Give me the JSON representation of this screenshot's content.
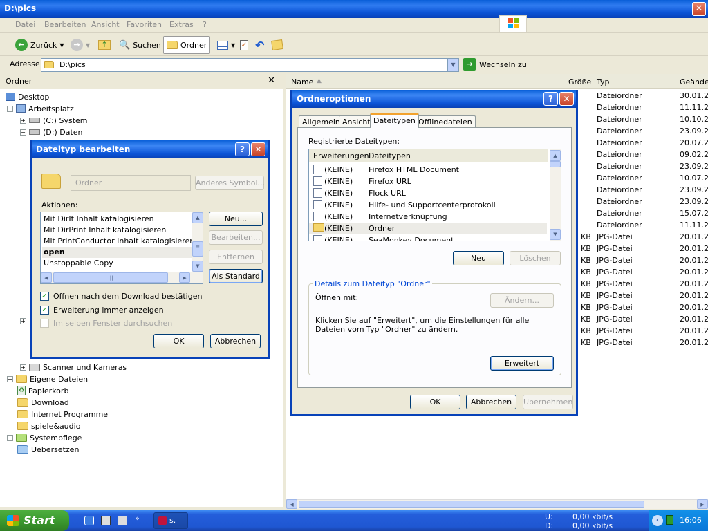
{
  "window": {
    "title": "D:\\pics"
  },
  "menu": [
    "Datei",
    "Bearbeiten",
    "Ansicht",
    "Favoriten",
    "Extras",
    "?"
  ],
  "toolbar": {
    "back": "Zurück",
    "search": "Suchen",
    "folders": "Ordner"
  },
  "address": {
    "label": "Adresse",
    "value": "D:\\pics",
    "go": "Wechseln zu"
  },
  "tree": {
    "header": "Ordner",
    "items": [
      {
        "label": "Desktop"
      },
      {
        "label": "Arbeitsplatz"
      },
      {
        "label": "(C:) System"
      },
      {
        "label": "(D:) Daten"
      },
      {
        "label": "Scanner und Kameras"
      },
      {
        "label": "Eigene Dateien"
      },
      {
        "label": "Papierkorb"
      },
      {
        "label": "Download"
      },
      {
        "label": "Internet Programme"
      },
      {
        "label": "spiele&audio"
      },
      {
        "label": "Systempflege"
      },
      {
        "label": "Uebersetzen"
      }
    ]
  },
  "list": {
    "headers": {
      "name": "Name",
      "size": "Größe",
      "type": "Typ",
      "changed": "Geände"
    },
    "rows": [
      {
        "size": "",
        "type": "Dateiordner",
        "date": "30.01.2"
      },
      {
        "size": "",
        "type": "Dateiordner",
        "date": "11.11.2"
      },
      {
        "size": "",
        "type": "Dateiordner",
        "date": "10.10.2"
      },
      {
        "size": "",
        "type": "Dateiordner",
        "date": "23.09.2"
      },
      {
        "size": "",
        "type": "Dateiordner",
        "date": "20.07.2"
      },
      {
        "size": "",
        "type": "Dateiordner",
        "date": "09.02.2"
      },
      {
        "size": "",
        "type": "Dateiordner",
        "date": "23.09.2"
      },
      {
        "size": "",
        "type": "Dateiordner",
        "date": "10.07.2"
      },
      {
        "size": "",
        "type": "Dateiordner",
        "date": "23.09.2"
      },
      {
        "size": "",
        "type": "Dateiordner",
        "date": "23.09.2"
      },
      {
        "size": "",
        "type": "Dateiordner",
        "date": "15.07.2"
      },
      {
        "size": "",
        "type": "Dateiordner",
        "date": "11.11.2"
      },
      {
        "size": "KB",
        "type": "JPG-Datei",
        "date": "20.01.2"
      },
      {
        "size": "KB",
        "type": "JPG-Datei",
        "date": "20.01.2"
      },
      {
        "size": "KB",
        "type": "JPG-Datei",
        "date": "20.01.2"
      },
      {
        "size": "KB",
        "type": "JPG-Datei",
        "date": "20.01.2"
      },
      {
        "size": "KB",
        "type": "JPG-Datei",
        "date": "20.01.2"
      },
      {
        "size": "KB",
        "type": "JPG-Datei",
        "date": "20.01.2"
      },
      {
        "size": "KB",
        "type": "JPG-Datei",
        "date": "20.01.2"
      },
      {
        "size": "KB",
        "type": "JPG-Datei",
        "date": "20.01.2"
      },
      {
        "size": "KB",
        "type": "JPG-Datei",
        "date": "20.01.2"
      },
      {
        "size": "KB",
        "type": "JPG-Datei",
        "date": "20.01.2"
      }
    ]
  },
  "folder_options": {
    "title": "Ordneroptionen",
    "tabs": [
      "Allgemein",
      "Ansicht",
      "Dateitypen",
      "Offlinedateien"
    ],
    "registered_label": "Registrierte Dateitypen:",
    "col_ext": "Erweiterungen",
    "col_type": "Dateitypen",
    "rows": [
      {
        "ext": "(KEINE)",
        "type": "Firefox HTML Document"
      },
      {
        "ext": "(KEINE)",
        "type": "Firefox URL"
      },
      {
        "ext": "(KEINE)",
        "type": "Flock URL"
      },
      {
        "ext": "(KEINE)",
        "type": "Hilfe- und Supportcenterprotokoll"
      },
      {
        "ext": "(KEINE)",
        "type": "Internetverknüpfung"
      },
      {
        "ext": "(KEINE)",
        "type": "Ordner"
      },
      {
        "ext": "(KEINE)",
        "type": "SeaMonkey Document"
      }
    ],
    "new_btn": "Neu",
    "delete_btn": "Löschen",
    "details_legend": "Details zum Dateityp \"Ordner\"",
    "open_with": "Öffnen mit:",
    "change_btn": "Ändern...",
    "details_text": "Klicken Sie auf \"Erweitert\", um die Einstellungen für alle Dateien vom Typ \"Ordner\" zu ändern.",
    "advanced_btn": "Erweitert",
    "ok": "OK",
    "cancel": "Abbrechen",
    "apply": "Übernehmen"
  },
  "edit_type": {
    "title": "Dateityp bearbeiten",
    "name_value": "Ordner",
    "change_icon": "Anderes Symbol...",
    "actions_label": "Aktionen:",
    "actions": [
      "Mit DirIt Inhalt katalogisieren",
      "Mit DirPrint Inhalt katalogisieren",
      "Mit PrintConductor Inhalt katalogisieren",
      "open",
      "Unstoppable Copy"
    ],
    "new": "Neu...",
    "edit": "Bearbeiten...",
    "remove": "Entfernen",
    "default": "Als Standard",
    "chk1": "Öffnen nach dem Download bestätigen",
    "chk2": "Erweiterung immer anzeigen",
    "chk3": "Im selben Fenster durchsuchen",
    "ok": "OK",
    "cancel": "Abbrechen"
  },
  "taskbar": {
    "start": "Start",
    "task": "s.",
    "upload_label": "U:",
    "download_label": "D:",
    "upload_rate": "0,00 kbit/s",
    "download_rate": "0,00 kbit/s",
    "clock": "16:06"
  }
}
